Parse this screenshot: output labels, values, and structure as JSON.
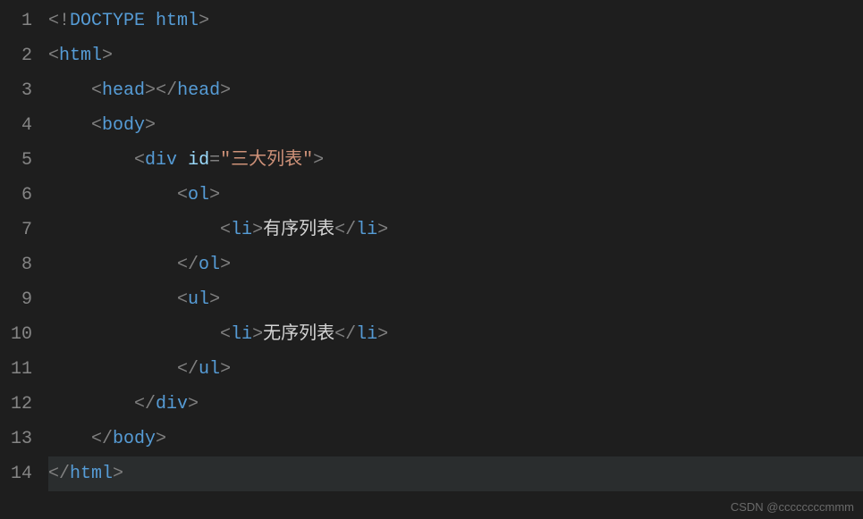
{
  "editor": {
    "lineNumbers": [
      "1",
      "2",
      "3",
      "4",
      "5",
      "6",
      "7",
      "8",
      "9",
      "10",
      "11",
      "12",
      "13",
      "14"
    ],
    "code": {
      "doctype": {
        "open": "<!",
        "keyword": "DOCTYPE",
        "value": "html",
        "close": ">"
      },
      "tags": {
        "html": "html",
        "head": "head",
        "body": "body",
        "div": "div",
        "ol": "ol",
        "ul": "ul",
        "li": "li"
      },
      "attrs": {
        "id": "id",
        "idValue": "\"三大列表\""
      },
      "text": {
        "orderedList": "有序列表",
        "unorderedList": "无序列表"
      },
      "punct": {
        "lt": "<",
        "gt": ">",
        "ltSlash": "</",
        "eq": "="
      }
    }
  },
  "watermark": "CSDN @ccccccccmmm"
}
